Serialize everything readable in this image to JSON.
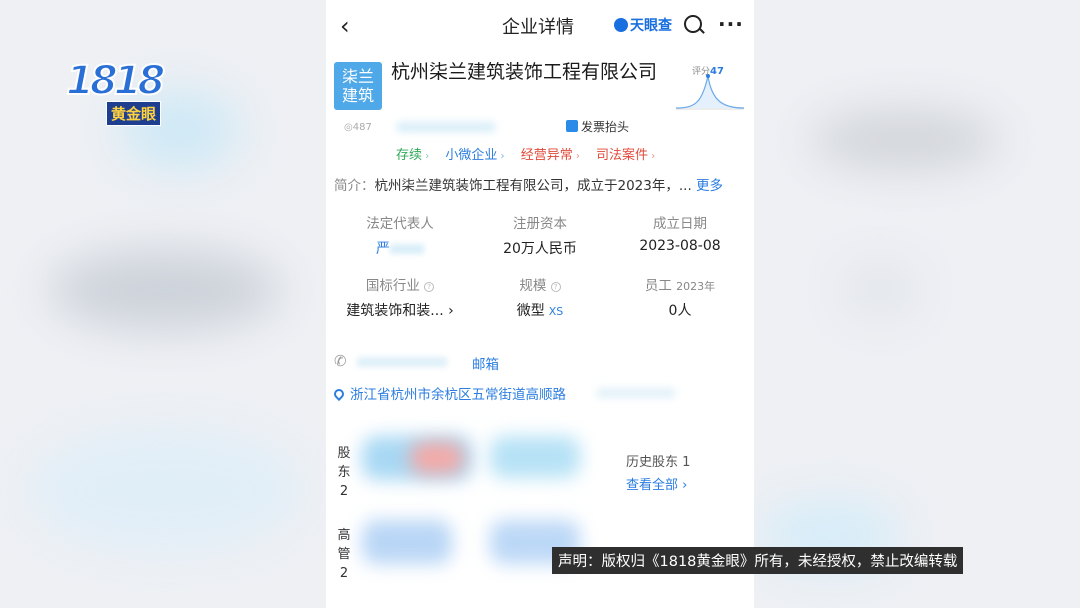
{
  "nav": {
    "back_label": "‹",
    "title": "企业详情",
    "brand": "天眼查",
    "more_label": "···"
  },
  "watermark_logo": {
    "number": "1818",
    "name": "黄金眼"
  },
  "company": {
    "logo_line1": "柒兰",
    "logo_line2": "建筑",
    "name": "杭州柒兰建筑装饰工程有限公司",
    "score_label": "评分",
    "score_value": "47",
    "views": "◎487",
    "invoice_label": "发票抬头"
  },
  "tags": [
    {
      "label": "存续",
      "color": "#2fa85a"
    },
    {
      "label": "小微企业",
      "color": "#2b7de0"
    },
    {
      "label": "经营异常",
      "color": "#e04a3a"
    },
    {
      "label": "司法案件",
      "color": "#e04a3a"
    }
  ],
  "intro": {
    "label": "简介：",
    "text": "杭州柒兰建筑装饰工程有限公司，成立于2023年，...",
    "more": "更多"
  },
  "info": {
    "legal_rep_label": "法定代表人",
    "legal_rep_value": "严",
    "capital_label": "注册资本",
    "capital_value": "20万人民币",
    "founded_label": "成立日期",
    "founded_value": "2023-08-08",
    "industry_label": "国标行业",
    "industry_value": "建筑装饰和装... ›",
    "scale_label": "规模",
    "scale_value": "微型",
    "scale_tag": "XS",
    "staff_label": "员工",
    "staff_year": "2023年",
    "staff_value": "0人"
  },
  "contact": {
    "email_label": "邮箱",
    "address": "浙江省杭州市余杭区五常街道高顺路"
  },
  "shareholders": {
    "label_chars": [
      "股",
      "东",
      "2"
    ],
    "history": "历史股东 1",
    "view_all": "查看全部 ›"
  },
  "executives": {
    "label_chars": [
      "高",
      "管",
      "2"
    ]
  },
  "notice": "声明：版权归《1818黄金眼》所有，未经授权，禁止改编转载"
}
